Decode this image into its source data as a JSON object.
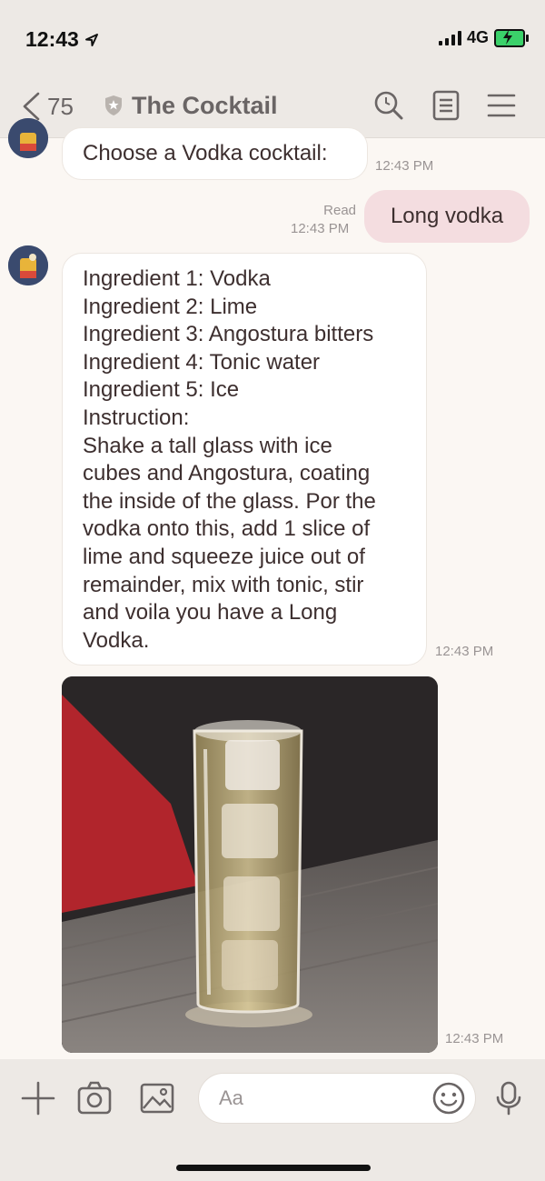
{
  "status": {
    "time": "12:43",
    "network": "4G"
  },
  "header": {
    "back_count": "75",
    "title": "The Cocktail"
  },
  "messages": {
    "m1": {
      "text": "Choose a Vodka cocktail:",
      "time": "12:43 PM"
    },
    "m2": {
      "text": "Long vodka",
      "read": "Read",
      "time": "12:43 PM"
    },
    "m3": {
      "lines": [
        "Ingredient 1: Vodka",
        "Ingredient 2: Lime",
        "Ingredient 3: Angostura bitters",
        "Ingredient 4: Tonic water",
        "Ingredient 5: Ice",
        "Instruction:",
        "Shake a tall glass with ice",
        "cubes and Angostura, coating",
        "the inside of the glass. Por the",
        "vodka onto this, add 1 slice of",
        "lime and squeeze juice out of",
        "remainder, mix with tonic, stir",
        "and voila you have a Long",
        "Vodka."
      ],
      "time": "12:43 PM"
    },
    "m4": {
      "time": "12:43 PM"
    }
  },
  "input": {
    "placeholder": "Aa"
  },
  "icons": {
    "back": "chevron-left-icon",
    "search": "search-icon",
    "notes": "notes-icon",
    "menu": "menu-icon",
    "add": "plus-icon",
    "camera": "camera-icon",
    "gallery": "image-icon",
    "emoji": "emoji-icon",
    "mic": "microphone-icon"
  },
  "colors": {
    "outgoing_bubble": "#f4dde0",
    "background": "#fbf7f3",
    "bar": "#ede9e5"
  }
}
